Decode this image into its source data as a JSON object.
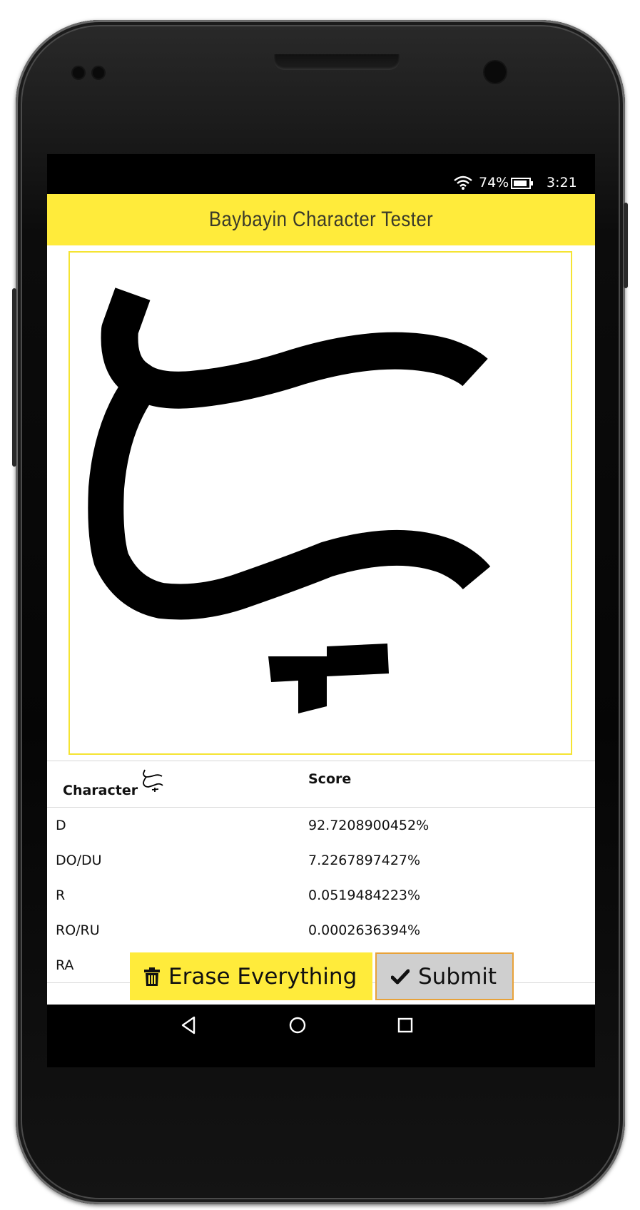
{
  "status_bar": {
    "battery_percent": "74%",
    "time": "3:21",
    "icons": [
      "wifi-icon",
      "battery-icon"
    ]
  },
  "app_bar": {
    "title": "Baybayin Character Tester",
    "color": "#ffeb3b"
  },
  "drawing_canvas": {
    "border_color": "#f5e432",
    "stroke_color": "#000000"
  },
  "results": {
    "headers": {
      "character": "Character",
      "score": "Score"
    },
    "rows": [
      {
        "character": "D",
        "score": "92.7208900452%"
      },
      {
        "character": "DO/DU",
        "score": "7.2267897427%"
      },
      {
        "character": "R",
        "score": "0.0519484223%"
      },
      {
        "character": "RO/RU",
        "score": "0.0002636394%"
      },
      {
        "character": "RA",
        "score": ""
      }
    ]
  },
  "actions": {
    "erase_label": "Erase Everything",
    "erase_icon": "trash-icon",
    "submit_label": "Submit",
    "submit_icon": "check-icon"
  },
  "nav_bar": {
    "buttons": [
      "back-icon",
      "home-icon",
      "recents-icon"
    ]
  }
}
